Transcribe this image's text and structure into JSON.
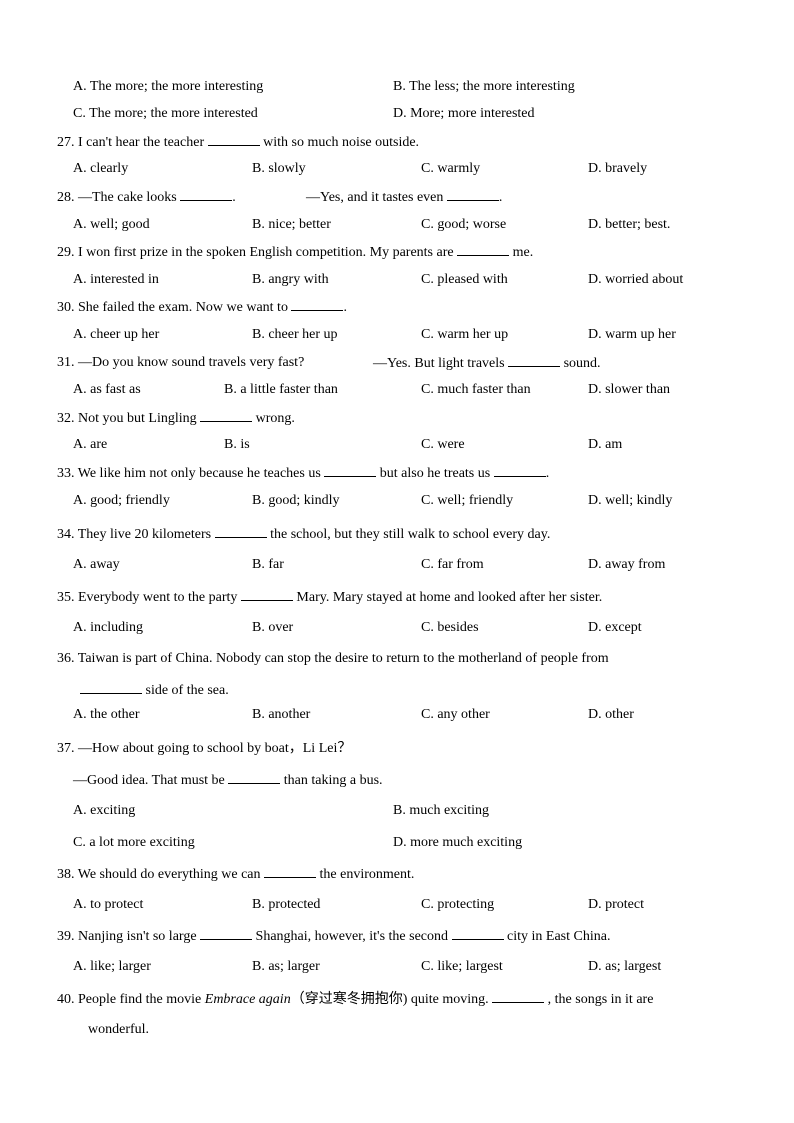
{
  "q26_options": {
    "A": "A. The more; the more interesting",
    "B": "B. The less; the more interesting",
    "C": "C. The more; the more interested",
    "D": "D. More; more interested"
  },
  "questions": [
    {
      "number": "27.",
      "stem_before": "I can't hear the teacher",
      "stem_after": "with so much noise outside.",
      "options": [
        "A. clearly",
        "B. slowly",
        "C. warmly",
        "D. bravely"
      ]
    },
    {
      "number": "28.",
      "stem_before": "—The cake looks",
      "stem_mid": ".",
      "stem_mid2": "—Yes, and it tastes even",
      "stem_after": ".",
      "options": [
        "A. well; good",
        "B. nice; better",
        "C. good; worse",
        "D. better; best."
      ]
    },
    {
      "number": "29.",
      "stem_before": "I won first prize in the spoken English competition. My parents are",
      "stem_after": "me.",
      "options": [
        "A. interested in",
        "B. angry with",
        "C. pleased with",
        "D. worried about"
      ]
    },
    {
      "number": "30.",
      "stem_before": "She failed the exam. Now we want to",
      "stem_after": ".",
      "options": [
        "A. cheer up her",
        "B. cheer her up",
        "C. warm her up",
        "D. warm up her"
      ]
    },
    {
      "number": "31.",
      "stem_before": "—Do you know sound travels very fast?",
      "stem_mid2": "—Yes. But light travels",
      "stem_after": "sound.",
      "options": [
        "A. as fast as",
        "B. a little faster than",
        "C. much faster than",
        "D. slower than"
      ]
    },
    {
      "number": "32.",
      "stem_before": "Not you but Lingling",
      "stem_after": "wrong.",
      "options": [
        "A. are",
        "B. is",
        "C. were",
        "D. am"
      ]
    },
    {
      "number": "33.",
      "stem_before": "We like him not only because he teaches us",
      "stem_mid": "but also he treats us",
      "stem_after": ".",
      "options": [
        "A. good; friendly",
        "B. good; kindly",
        "C. well; friendly",
        "D. well; kindly"
      ]
    },
    {
      "number": "34.",
      "stem_before": "They live 20 kilometers",
      "stem_after": "the school, but they still walk to school every day.",
      "options": [
        "A. away",
        "B. far",
        "C. far from",
        "D. away from"
      ]
    },
    {
      "number": "35.",
      "stem_before": "Everybody went to the party",
      "stem_after": "Mary. Mary stayed at home and looked after her sister.",
      "options": [
        "A. including",
        "B. over",
        "C. besides",
        "D. except"
      ]
    },
    {
      "number": "36.",
      "stem_before": "Taiwan is part of China. Nobody can stop the desire to return to the motherland of people from",
      "stem_line2": "side of the sea.",
      "options": [
        "A. the other",
        "B. another",
        "C. any other",
        "D. other"
      ]
    },
    {
      "number": "37.",
      "stem_before": "—How about going to school by boat，Li Lei？",
      "stem_line2_before": "—Good idea. That must be",
      "stem_line2_after": "than taking a bus.",
      "options": [
        "A. exciting",
        "B. much exciting",
        "C. a lot more exciting",
        "D. more much exciting"
      ]
    },
    {
      "number": "38.",
      "stem_before": "We should do everything we can",
      "stem_after": "the environment.",
      "options": [
        "A. to protect",
        "B. protected",
        "C. protecting",
        "D. protect"
      ]
    },
    {
      "number": "39.",
      "stem_before": "Nanjing isn't so large",
      "stem_mid": "Shanghai, however, it's the second",
      "stem_after": "city in East China.",
      "options": [
        "A. like; larger",
        "B. as; larger",
        "C. like; largest",
        "D. as; largest"
      ]
    },
    {
      "number": "40.",
      "stem_before": "People find the movie",
      "title_italic": "Embrace again",
      "title_cn": "（穿过寒冬拥抱你)",
      "stem_mid": "quite moving.",
      "stem_after": ", the songs in it are",
      "stem_line2": "wonderful."
    }
  ]
}
